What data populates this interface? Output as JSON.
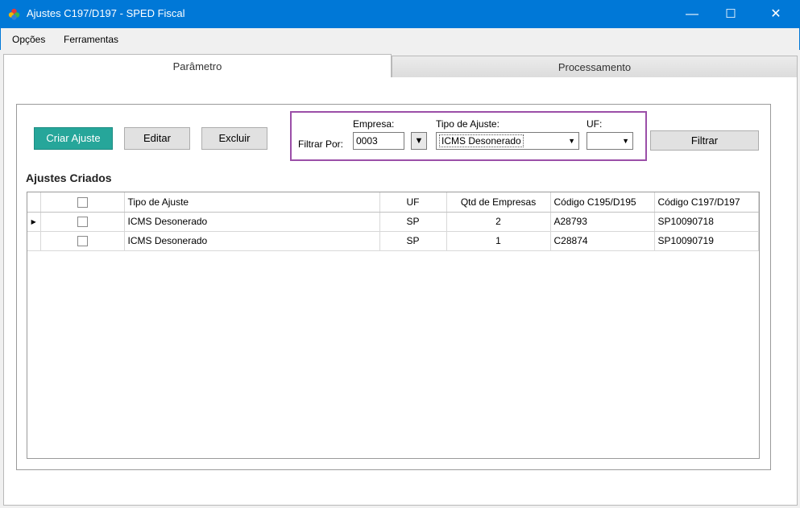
{
  "window": {
    "title": "Ajustes C197/D197 - SPED Fiscal",
    "minimize": "—",
    "maximize": "☐",
    "close": "✕"
  },
  "menu": [
    {
      "label": "Opções"
    },
    {
      "label": "Ferramentas"
    }
  ],
  "tabs": [
    {
      "label": "Parâmetro",
      "active": true
    },
    {
      "label": "Processamento",
      "active": false
    }
  ],
  "toolbar": {
    "criar_label": "Criar Ajuste",
    "editar_label": "Editar",
    "excluir_label": "Excluir",
    "filtrar_label": "Filtrar"
  },
  "filter": {
    "filtrar_por_label": "Filtrar Por:",
    "empresa_label": "Empresa:",
    "empresa_value": "0003",
    "tipo_label": "Tipo de Ajuste:",
    "tipo_value": "ICMS Desonerado",
    "uf_label": "UF:",
    "uf_value": ""
  },
  "section_title": "Ajustes Criados",
  "table": {
    "columns": [
      "",
      "Tipo de Ajuste",
      "UF",
      "Qtd de Empresas",
      "Código C195/D195",
      "Código C197/D197"
    ],
    "rows": [
      {
        "tipo": "ICMS Desonerado",
        "uf": "SP",
        "qtd": "2",
        "c195": "A28793",
        "c197": "SP10090718",
        "current": true
      },
      {
        "tipo": "ICMS Desonerado",
        "uf": "SP",
        "qtd": "1",
        "c195": "C28874",
        "c197": "SP10090719",
        "current": false
      }
    ]
  },
  "colors": {
    "titlebar": "#0078d7",
    "primary_button": "#26a69a",
    "filter_highlight": "#9b4fa8"
  }
}
